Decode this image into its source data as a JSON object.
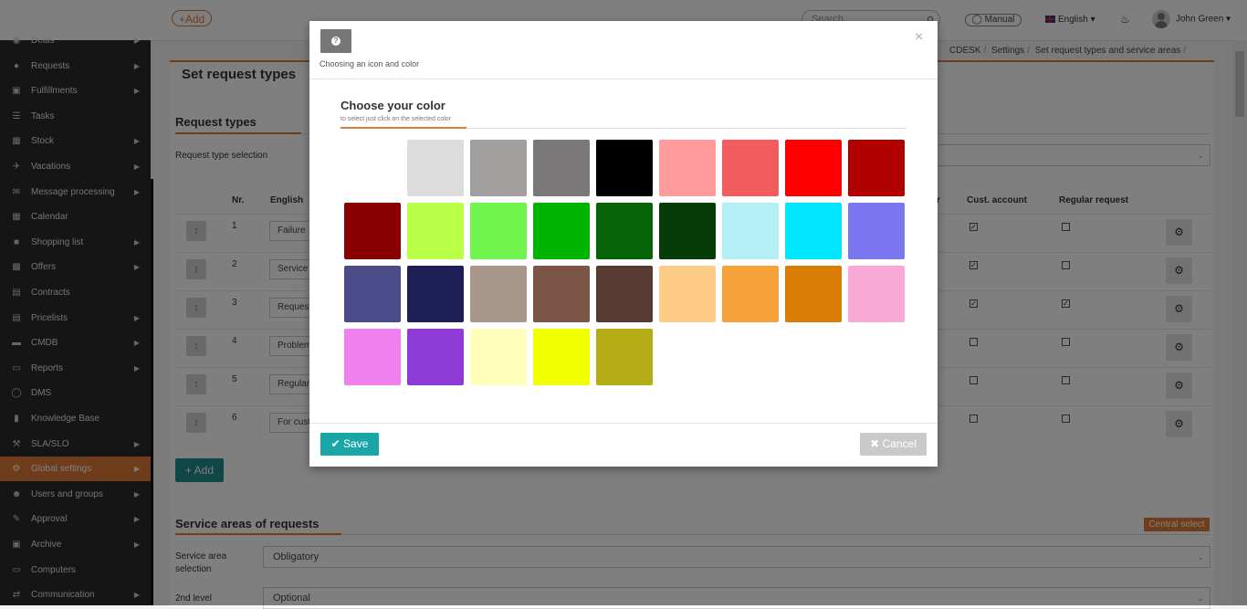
{
  "topbar": {
    "add_label": "+Add",
    "search_placeholder": "Search",
    "manual_label": "Manual",
    "language": "English",
    "user_name": "John Green"
  },
  "sidebar": {
    "items": [
      {
        "label": "Deals",
        "icon": "handshake-icon",
        "arrow": true
      },
      {
        "label": "Requests",
        "icon": "requests-icon",
        "arrow": true
      },
      {
        "label": "Fulfillments",
        "icon": "box-icon",
        "arrow": true
      },
      {
        "label": "Tasks",
        "icon": "tasks-icon",
        "arrow": false
      },
      {
        "label": "Stock",
        "icon": "stock-icon",
        "arrow": true
      },
      {
        "label": "Vacations",
        "icon": "plane-icon",
        "arrow": true
      },
      {
        "label": "Message processing",
        "icon": "envelope-icon",
        "arrow": true
      },
      {
        "label": "Calendar",
        "icon": "calendar-icon",
        "arrow": false
      },
      {
        "label": "Shopping list",
        "icon": "cart-icon",
        "arrow": true
      },
      {
        "label": "Offers",
        "icon": "gift-icon",
        "arrow": true
      },
      {
        "label": "Contracts",
        "icon": "document-icon",
        "arrow": false
      },
      {
        "label": "Pricelists",
        "icon": "pricelist-icon",
        "arrow": true
      },
      {
        "label": "CMDB",
        "icon": "folder-icon",
        "arrow": true
      },
      {
        "label": "Reports",
        "icon": "folder-open-icon",
        "arrow": true
      },
      {
        "label": "DMS",
        "icon": "database-icon",
        "arrow": false
      },
      {
        "label": "Knowledge Base",
        "icon": "book-icon",
        "arrow": false
      },
      {
        "label": "SLA/SLO",
        "icon": "gavel-icon",
        "arrow": true
      },
      {
        "label": "Global settings",
        "icon": "gears-icon",
        "arrow": true,
        "active": true
      },
      {
        "label": "Users and groups",
        "icon": "users-icon",
        "arrow": true
      },
      {
        "label": "Approval",
        "icon": "approval-icon",
        "arrow": true
      },
      {
        "label": "Archive",
        "icon": "archive-icon",
        "arrow": true
      },
      {
        "label": "Computers",
        "icon": "laptop-icon",
        "arrow": false
      },
      {
        "label": "Communication",
        "icon": "exchange-icon",
        "arrow": true
      }
    ]
  },
  "breadcrumbs": [
    "CDESK",
    "Settings",
    "Set request types and service areas"
  ],
  "page": {
    "title": "Set request types",
    "request_types": {
      "section_title": "Request types",
      "selection_label": "Request type selection",
      "headers": {
        "nr": "Nr.",
        "english": "English",
        "partial": "r",
        "cust_account": "Cust. account",
        "regular_request": "Regular request"
      },
      "rows": [
        {
          "nr": "1",
          "name": "Failure",
          "cust": true,
          "regular": false
        },
        {
          "nr": "2",
          "name": "Service",
          "cust": true,
          "regular": false
        },
        {
          "nr": "3",
          "name": "Request",
          "cust": true,
          "regular": true
        },
        {
          "nr": "4",
          "name": "Problem",
          "cust": false,
          "regular": false
        },
        {
          "nr": "5",
          "name": "Regular",
          "cust": false,
          "regular": false
        },
        {
          "nr": "6",
          "name": "For cust",
          "cust": false,
          "regular": false
        }
      ],
      "add_label": "+ Add"
    },
    "service_areas": {
      "section_title": "Service areas of requests",
      "badge": "Central select",
      "selection_label_1": "Service area",
      "selection_label_2": "selection",
      "selection_value": "Obligatory",
      "level2_label": "2nd level",
      "level2_value": "Optional"
    }
  },
  "modal": {
    "subtitle": "Choosing an icon and color",
    "close_glyph": "×",
    "color_title": "Choose your color",
    "color_hint": "to select just click on the selected color",
    "colors": [
      "#ffffff",
      "#dcdcdc",
      "#a09f9e",
      "#7a7878",
      "#000000",
      "#ff9b9b",
      "#f25c5c",
      "#ff0000",
      "#b00000",
      "#880000",
      "#b9ff4a",
      "#6ef44c",
      "#00b400",
      "#046407",
      "#063c08",
      "#b3eff4",
      "#00e6ff",
      "#7b77f1",
      "#4c4b8a",
      "#1f1f57",
      "#aa978b",
      "#7b5647",
      "#573b33",
      "#ffcc88",
      "#f5a23a",
      "#da7d06",
      "#f9a9d5",
      "#ef81ef",
      "#8e3bd6",
      "#ffffbb",
      "#f1ff00",
      "#b4ad18"
    ],
    "save_label": "Save",
    "cancel_label": "Cancel"
  }
}
